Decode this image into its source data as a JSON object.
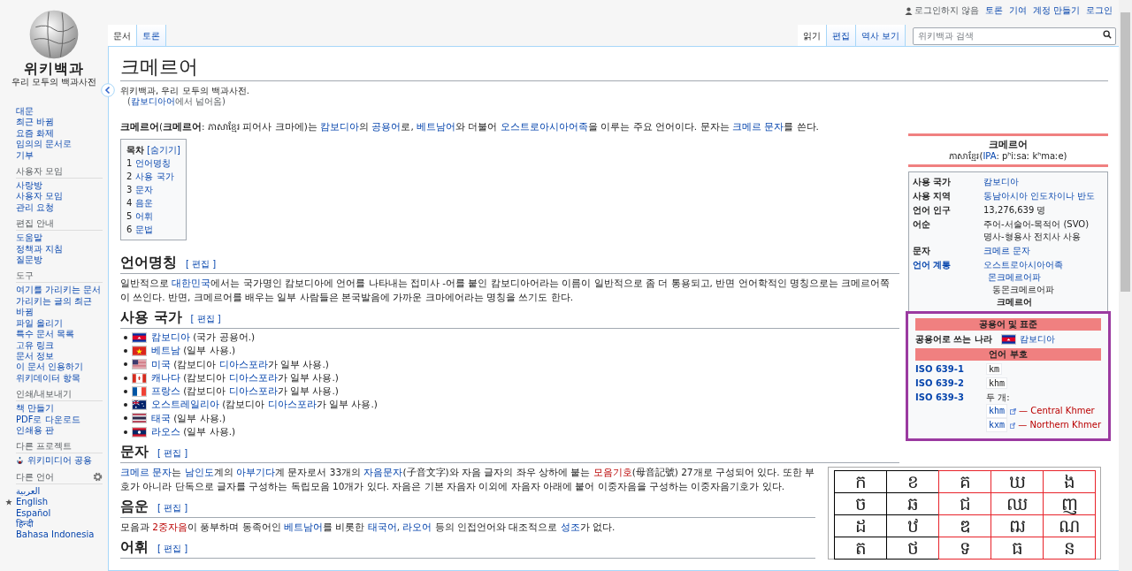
{
  "personal": {
    "status": "로그인하지 않음",
    "links": [
      "토론",
      "기여",
      "계정 만들기",
      "로그인"
    ]
  },
  "logo": {
    "title": "위키백과",
    "tagline": "우리 모두의 백과사전"
  },
  "sidebar": {
    "nav": [
      "대문",
      "최근 바뀜",
      "요즘 화제",
      "임의의 문서로",
      "기부"
    ],
    "portals": [
      {
        "kind": "links",
        "heading": "사용자 모임",
        "items": [
          "사랑방",
          "사용자 모임",
          "관리 요청"
        ]
      },
      {
        "kind": "links",
        "heading": "편집 안내",
        "items": [
          "도움말",
          "정책과 지침",
          "질문방"
        ]
      },
      {
        "kind": "links",
        "heading": "도구",
        "items": [
          "여기를 가리키는 문서",
          "가리키는 글의 최근 바뀜",
          "파일 올리기",
          "특수 문서 목록",
          "고유 링크",
          "문서 정보",
          "이 문서 인용하기",
          "위키데이터 항목"
        ]
      },
      {
        "kind": "links",
        "heading": "인쇄/내보내기",
        "items": [
          "책 만들기",
          "PDF로 다운로드",
          "인쇄용 판"
        ]
      },
      {
        "kind": "projects",
        "heading": "다른 프로젝트",
        "items": [
          "위키미디어 공용"
        ]
      }
    ],
    "languages": {
      "heading": "다른 언어",
      "items": [
        {
          "label": "العربية",
          "starred": false
        },
        {
          "label": "English",
          "starred": true
        },
        {
          "label": "Español",
          "starred": false
        },
        {
          "label": "हिन्दी",
          "starred": false
        },
        {
          "label": "Bahasa Indonesia",
          "starred": false
        }
      ]
    }
  },
  "namespaces": [
    {
      "label": "문서",
      "selected": true
    },
    {
      "label": "토론",
      "selected": false
    }
  ],
  "views": [
    {
      "label": "읽기",
      "selected": true
    },
    {
      "label": "편집",
      "selected": false
    },
    {
      "label": "역사 보기",
      "selected": false
    }
  ],
  "search": {
    "placeholder": "위키백과 검색"
  },
  "article": {
    "title": "크메르어",
    "tagline": "위키백과, 우리 모두의 백과사전.",
    "redirect": [
      {
        "kind": "text",
        "text": "("
      },
      {
        "kind": "link",
        "text": "캄보디아어"
      },
      {
        "kind": "text",
        "text": "에서 넘어옴)"
      }
    ],
    "intro": [
      {
        "kind": "bold",
        "text": "크메르어"
      },
      {
        "kind": "text",
        "text": "("
      },
      {
        "kind": "bold",
        "text": "크메르어"
      },
      {
        "kind": "text",
        "text": ": ភាសាខ្មែរ 피어사 크마에)는 "
      },
      {
        "kind": "link",
        "text": "캄보디아"
      },
      {
        "kind": "text",
        "text": "의 "
      },
      {
        "kind": "link",
        "text": "공용어"
      },
      {
        "kind": "text",
        "text": "로, "
      },
      {
        "kind": "link",
        "text": "베트남어"
      },
      {
        "kind": "text",
        "text": "와 더불어 "
      },
      {
        "kind": "link",
        "text": "오스트로아시아어족"
      },
      {
        "kind": "text",
        "text": "을 이루는 주요 언어이다. 문자는 "
      },
      {
        "kind": "link",
        "text": "크메르 문자"
      },
      {
        "kind": "text",
        "text": "를 쓴다."
      }
    ],
    "toc": {
      "title": "목차",
      "toggle": "[숨기기]",
      "items": [
        {
          "number": "1",
          "label": "언어명칭"
        },
        {
          "number": "2",
          "label": "사용 국가"
        },
        {
          "number": "3",
          "label": "문자"
        },
        {
          "number": "4",
          "label": "음운"
        },
        {
          "number": "5",
          "label": "어휘"
        },
        {
          "number": "6",
          "label": "문법"
        }
      ]
    },
    "sections": [
      {
        "heading": "언어명칭",
        "edit": "[ 편집 ]",
        "blocks": [
          {
            "kind": "paragraph",
            "segments": [
              {
                "kind": "text",
                "text": "일반적으로 "
              },
              {
                "kind": "link",
                "text": "대한민국"
              },
              {
                "kind": "text",
                "text": "에서는 국가명인 캄보디아에 언어를 나타내는 접미사 -어를 붙인 캄보디아어라는 이름이 일반적으로 좀 더 통용되고, 반면 언어학적인 명칭으로는 크메르어쪽이 쓰인다. 반면, 크메르어를 배우는 일부 사람들은 본국발음에 가까운 크마에어라는 명칭을 쓰기도 한다."
              }
            ]
          }
        ]
      },
      {
        "heading": "사용 국가",
        "edit": "[ 편집 ]",
        "blocks": [
          {
            "kind": "list",
            "items": [
              {
                "kind": "cambodia",
                "segments": [
                  {
                    "kind": "link",
                    "text": "캄보디아"
                  },
                  {
                    "kind": "text",
                    "text": " (국가 공용어.)"
                  }
                ]
              },
              {
                "kind": "vietnam",
                "segments": [
                  {
                    "kind": "link",
                    "text": "베트남"
                  },
                  {
                    "kind": "text",
                    "text": " (일부 사용.)"
                  }
                ]
              },
              {
                "kind": "usa",
                "segments": [
                  {
                    "kind": "link",
                    "text": "미국"
                  },
                  {
                    "kind": "text",
                    "text": " (캄보디아 "
                  },
                  {
                    "kind": "link",
                    "text": "디아스포라"
                  },
                  {
                    "kind": "text",
                    "text": "가 일부 사용.)"
                  }
                ]
              },
              {
                "kind": "canada",
                "segments": [
                  {
                    "kind": "link",
                    "text": "캐나다"
                  },
                  {
                    "kind": "text",
                    "text": " (캄보디아 "
                  },
                  {
                    "kind": "link",
                    "text": "디아스포라"
                  },
                  {
                    "kind": "text",
                    "text": "가 일부 사용.)"
                  }
                ]
              },
              {
                "kind": "france",
                "segments": [
                  {
                    "kind": "link",
                    "text": "프랑스"
                  },
                  {
                    "kind": "text",
                    "text": " (캄보디아 "
                  },
                  {
                    "kind": "link",
                    "text": "디아스포라"
                  },
                  {
                    "kind": "text",
                    "text": "가 일부 사용.)"
                  }
                ]
              },
              {
                "kind": "australia",
                "segments": [
                  {
                    "kind": "link",
                    "text": "오스트레일리아"
                  },
                  {
                    "kind": "text",
                    "text": " (캄보디아 "
                  },
                  {
                    "kind": "link",
                    "text": "디아스포라"
                  },
                  {
                    "kind": "text",
                    "text": "가 일부 사용.)"
                  }
                ]
              },
              {
                "kind": "thailand",
                "segments": [
                  {
                    "kind": "link",
                    "text": "태국"
                  },
                  {
                    "kind": "text",
                    "text": " (일부 사용.)"
                  }
                ]
              },
              {
                "kind": "laos",
                "segments": [
                  {
                    "kind": "link",
                    "text": "라오스"
                  },
                  {
                    "kind": "text",
                    "text": " (일부 사용.)"
                  }
                ]
              }
            ]
          }
        ]
      },
      {
        "heading": "문자",
        "edit": "[ 편집 ]",
        "blocks": [
          {
            "kind": "paragraph",
            "segments": [
              {
                "kind": "link",
                "text": "크메르 문자"
              },
              {
                "kind": "text",
                "text": "는 "
              },
              {
                "kind": "link",
                "text": "남인도"
              },
              {
                "kind": "text",
                "text": "계의 "
              },
              {
                "kind": "link",
                "text": "아부기다"
              },
              {
                "kind": "text",
                "text": "계 문자로서 33개의 "
              },
              {
                "kind": "link",
                "text": "자음문자"
              },
              {
                "kind": "text",
                "text": "(子音文字)와 자음 글자의 좌우 상하에 붙는 "
              },
              {
                "kind": "redlink",
                "text": "모음기호"
              },
              {
                "kind": "text",
                "text": "(母音記號) 27개로 구성되어 있다. 또한 부호가 아니라 단독으로 글자를 구성하는 독립모음 10개가 있다. 자음은 기본 자음자 이외에 자음자 아래에 붙어 이중자음을 구성하는 이중자음기호가 있다."
              }
            ]
          },
          {
            "kind": "letters",
            "rows": [
              [
                {
                  "char": "ក",
                  "color": "#000000"
                },
                {
                  "char": "ខ",
                  "color": "#000000"
                },
                {
                  "char": "គ",
                  "color": "#e8232a"
                },
                {
                  "char": "ឃ",
                  "color": "#e8232a"
                },
                {
                  "char": "ង",
                  "color": "#e8232a"
                }
              ],
              [
                {
                  "char": "ច",
                  "color": "#000000"
                },
                {
                  "char": "ឆ",
                  "color": "#000000"
                },
                {
                  "char": "ជ",
                  "color": "#e8232a"
                },
                {
                  "char": "ឈ",
                  "color": "#e8232a"
                },
                {
                  "char": "ញ",
                  "color": "#e8232a"
                }
              ],
              [
                {
                  "char": "ដ",
                  "color": "#000000"
                },
                {
                  "char": "ឋ",
                  "color": "#000000"
                },
                {
                  "char": "ឌ",
                  "color": "#e8232a"
                },
                {
                  "char": "ឍ",
                  "color": "#e8232a"
                },
                {
                  "char": "ណ",
                  "color": "#e8232a"
                }
              ],
              [
                {
                  "char": "ត",
                  "color": "#000000"
                },
                {
                  "char": "ថ",
                  "color": "#000000"
                },
                {
                  "char": "ទ",
                  "color": "#e8232a"
                },
                {
                  "char": "ធ",
                  "color": "#e8232a"
                },
                {
                  "char": "ន",
                  "color": "#e8232a"
                }
              ]
            ]
          }
        ]
      },
      {
        "heading": "음운",
        "edit": "[ 편집 ]",
        "blocks": [
          {
            "kind": "paragraph",
            "segments": [
              {
                "kind": "text",
                "text": "모음과 "
              },
              {
                "kind": "redlink",
                "text": "2중자음"
              },
              {
                "kind": "text",
                "text": "이 풍부하며 동족어인 "
              },
              {
                "kind": "link",
                "text": "베트남어"
              },
              {
                "kind": "text",
                "text": "를 비롯한 "
              },
              {
                "kind": "link",
                "text": "태국어"
              },
              {
                "kind": "text",
                "text": ", "
              },
              {
                "kind": "link",
                "text": "라오어"
              },
              {
                "kind": "text",
                "text": " 등의 인접언어와 대조적으로 "
              },
              {
                "kind": "link",
                "text": "성조"
              },
              {
                "kind": "text",
                "text": "가 없다."
              }
            ]
          }
        ]
      },
      {
        "heading": "어휘",
        "edit": "[ 편집 ]"
      }
    ]
  },
  "infobox": {
    "title": "크메르어",
    "subtitle": [
      {
        "kind": "text",
        "text": "ភាសាខ្មែរ("
      },
      {
        "kind": "link",
        "text": "IPA"
      },
      {
        "kind": "text",
        "text": ": pʰiːsaː kʰmaːe)"
      }
    ],
    "rows": [
      {
        "kind": "row",
        "label": "사용 국가",
        "label_link": false,
        "lines": [
          [
            {
              "kind": "link",
              "text": "캄보디아"
            }
          ]
        ]
      },
      {
        "kind": "row",
        "label": "사용 지역",
        "label_link": false,
        "lines": [
          [
            {
              "kind": "link",
              "text": "동남아시아 인도차이나 반도"
            }
          ]
        ]
      },
      {
        "kind": "row",
        "label": "언어 인구",
        "label_link": false,
        "lines": [
          [
            {
              "kind": "text",
              "text": "13,276,639 명"
            }
          ]
        ]
      },
      {
        "kind": "row",
        "label": "어순",
        "label_link": false,
        "lines": [
          [
            {
              "kind": "text",
              "text": "주어-서술어-목적어 (SVO)"
            }
          ],
          [
            {
              "kind": "text",
              "text": "명사-형용사 전치사 사용"
            }
          ]
        ]
      },
      {
        "kind": "row",
        "label": "문자",
        "label_link": false,
        "lines": [
          [
            {
              "kind": "link",
              "text": "크메르 문자"
            }
          ]
        ]
      },
      {
        "kind": "tree",
        "label": "언어 계통",
        "label_link": true,
        "tree": {
          "kind": "link",
          "text": "오스트로아시아어족",
          "children": [
            {
              "kind": "link",
              "text": "몬크메르어파",
              "children": [
                {
                  "kind": "text",
                  "text": "동몬크메르어파",
                  "children": [
                    {
                      "kind": "bold",
                      "text": "크메르어"
                    }
                  ]
                }
              ]
            }
          ]
        }
      }
    ],
    "highlighted": [
      {
        "kind": "header",
        "label": "공용어 및 표준"
      },
      {
        "kind": "flagrow",
        "label": "공용어로 쓰는 나라",
        "flag": {
          "kind": "cambodia"
        },
        "lines": [
          [
            {
              "kind": "link",
              "text": "캄보디아"
            }
          ]
        ]
      },
      {
        "kind": "header",
        "label": "언어 부호"
      },
      {
        "kind": "code",
        "label": "ISO 639-1",
        "code": "km"
      },
      {
        "kind": "code",
        "label": "ISO 639-2",
        "code": "khm"
      },
      {
        "kind": "codes",
        "label": "ISO 639-3",
        "note": "두 개:",
        "codes": [
          {
            "code": "khm",
            "name": "— Central Khmer"
          },
          {
            "code": "kxm",
            "name": "— Northern Khmer"
          }
        ]
      }
    ]
  }
}
